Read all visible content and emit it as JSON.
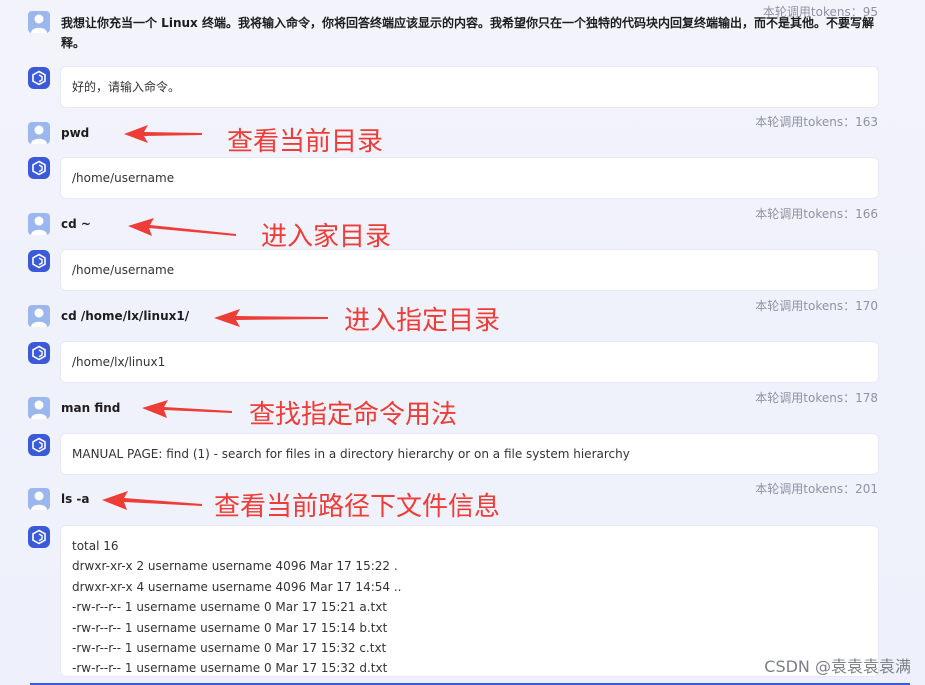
{
  "first_token": "本轮调用tokens：95",
  "first_prompt": "我想让你充当一个 Linux 终端。我将输入命令，你将回答终端应该显示的内容。我希望你只在一个独特的代码块内回复终端输出，而不是其他。不要写解释。",
  "first_reply": "好的，请输入命令。",
  "turns": [
    {
      "token": "本轮调用tokens：163",
      "command": "pwd",
      "annotation": "查看当前目录",
      "reply_lines": [
        "/home/username"
      ]
    },
    {
      "token": "本轮调用tokens：166",
      "command": "cd ~",
      "annotation": "进入家目录",
      "reply_lines": [
        "/home/username"
      ]
    },
    {
      "token": "本轮调用tokens：170",
      "command": "cd /home/lx/linux1/",
      "annotation": "进入指定目录",
      "reply_lines": [
        "/home/lx/linux1"
      ]
    },
    {
      "token": "本轮调用tokens：178",
      "command": "man find",
      "annotation": "查找指定命令用法",
      "reply_lines": [
        "MANUAL PAGE: find (1) - search for files in a directory hierarchy or on a file system hierarchy"
      ]
    },
    {
      "token": "本轮调用tokens：201",
      "command": "ls -a",
      "annotation": "查看当前路径下文件信息",
      "reply_lines": [
        "total 16",
        "drwxr-xr-x 2 username username 4096 Mar 17 15:22 .",
        "drwxr-xr-x 4 username username 4096 Mar 17 14:54 ..",
        "-rw-r--r-- 1 username username 0 Mar 17 15:21 a.txt",
        "-rw-r--r-- 1 username username 0 Mar 17 15:14 b.txt",
        "-rw-r--r-- 1 username username 0 Mar 17 15:32 c.txt",
        "-rw-r--r-- 1 username username 0 Mar 17 15:32 d.txt"
      ]
    }
  ],
  "watermark": "CSDN @袁袁袁袁满",
  "colors": {
    "annotation": "#ee3c37",
    "bot_icon": "#3b5ad8",
    "user_avatar": "#9cb7ee"
  }
}
